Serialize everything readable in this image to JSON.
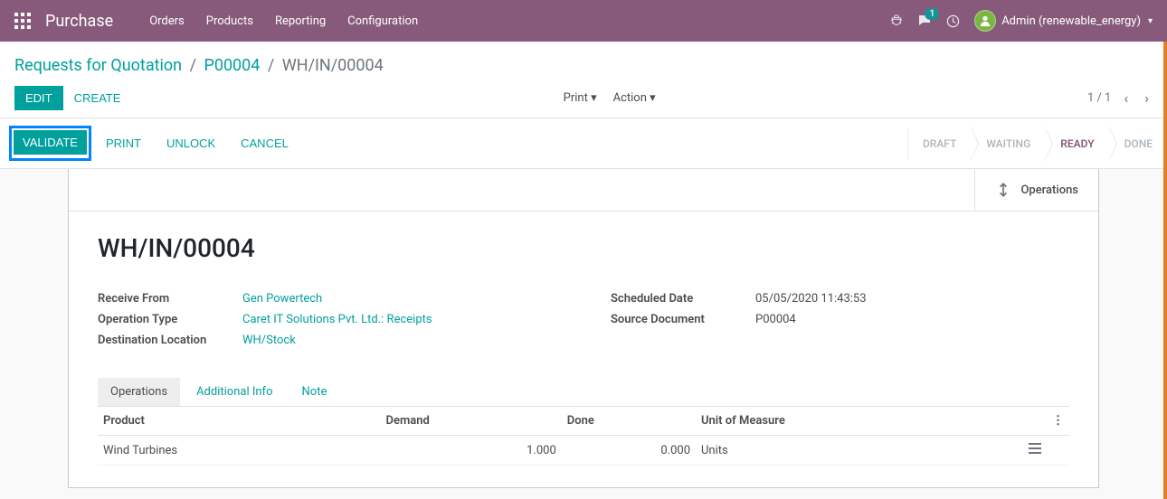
{
  "navbar": {
    "brand": "Purchase",
    "menu": [
      "Orders",
      "Products",
      "Reporting",
      "Configuration"
    ],
    "chat_count": "1",
    "user": "Admin (renewable_energy)"
  },
  "breadcrumb": {
    "parts": [
      "Requests for Quotation",
      "P00004",
      "WH/IN/00004"
    ]
  },
  "toolbar": {
    "edit": "Edit",
    "create": "Create",
    "print": "Print",
    "action": "Action",
    "pager": "1 / 1"
  },
  "statusbar": {
    "buttons": {
      "validate": "Validate",
      "print": "Print",
      "unlock": "Unlock",
      "cancel": "Cancel"
    },
    "steps": [
      "Draft",
      "Waiting",
      "Ready",
      "Done"
    ],
    "active_index": 2
  },
  "stat_button": {
    "label": "Operations"
  },
  "record": {
    "title": "WH/IN/00004",
    "left_fields": [
      {
        "label": "Receive From",
        "value": "Gen Powertech",
        "link": true
      },
      {
        "label": "Operation Type",
        "value": "Caret IT Solutions Pvt. Ltd.: Receipts",
        "link": true
      },
      {
        "label": "Destination Location",
        "value": "WH/Stock",
        "link": true
      }
    ],
    "right_fields": [
      {
        "label": "Scheduled Date",
        "value": "05/05/2020 11:43:53",
        "link": false
      },
      {
        "label": "Source Document",
        "value": "P00004",
        "link": false
      }
    ]
  },
  "tabs": [
    "Operations",
    "Additional Info",
    "Note"
  ],
  "table": {
    "columns": [
      "Product",
      "Demand",
      "Done",
      "Unit of Measure"
    ],
    "rows": [
      {
        "product": "Wind Turbines",
        "demand": "1.000",
        "done": "0.000",
        "uom": "Units"
      }
    ]
  }
}
